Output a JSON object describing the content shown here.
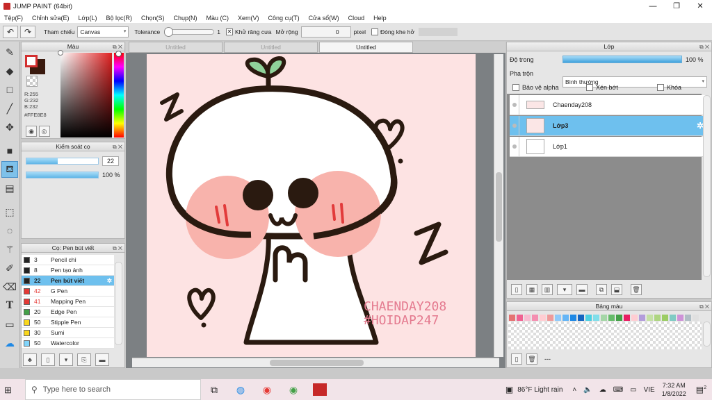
{
  "window": {
    "title": "JUMP PAINT (64bit)",
    "controls": [
      "—",
      "❐",
      "✕"
    ]
  },
  "menu": [
    "Tệp(F)",
    "Chỉnh sửa(E)",
    "Lớp(L)",
    "Bộ lọc(R)",
    "Chọn(S)",
    "Chụp(N)",
    "Màu (C)",
    "Xem(V)",
    "Công cụ(T)",
    "Cửa sổ(W)",
    "Cloud",
    "Help"
  ],
  "toolbar": {
    "undo_icon": "undo-icon",
    "redo_icon": "redo-icon",
    "reference_label": "Tham chiếu",
    "reference_value": "Canvas",
    "tolerance_label": "Tolerance",
    "tolerance_value": "1",
    "antialias_label": "Khử răng cưa",
    "antialias_checked": true,
    "expand_label": "Mở rộng",
    "expand_value": "0",
    "expand_unit": "pixel",
    "close_gap_label": "Đóng khe hở",
    "close_gap_checked": false
  },
  "color_panel": {
    "title": "Màu",
    "r": "R:255",
    "g": "G:232",
    "b": "B:232",
    "hex": "#FFE8E8",
    "fg_color": "#d32f2f",
    "bg_color": "#3a1a0e"
  },
  "brush_control": {
    "title": "Kiểm soát cọ",
    "size": "22",
    "size_fraction": 0.44,
    "opacity": "100 %",
    "opacity_fraction": 1.0
  },
  "brush_list": {
    "title": "Cọ: Pen bút viết",
    "items": [
      {
        "size": "3",
        "name": "Pencil chì",
        "color": "#222222",
        "selected": false
      },
      {
        "size": "8",
        "name": "Pen tạo ảnh",
        "color": "#222222",
        "selected": false
      },
      {
        "size": "22",
        "name": "Pen bút viết",
        "color": "#222222",
        "selected": true
      },
      {
        "size": "42",
        "name": "G Pen",
        "color": "#e53935",
        "selected": false
      },
      {
        "size": "41",
        "name": "Mapping Pen",
        "color": "#e53935",
        "selected": false
      },
      {
        "size": "20",
        "name": "Edge Pen",
        "color": "#43a047",
        "selected": false
      },
      {
        "size": "50",
        "name": "Stipple Pen",
        "color": "#f9d71c",
        "selected": false
      },
      {
        "size": "30",
        "name": "Sumi",
        "color": "#f9d71c",
        "selected": false
      },
      {
        "size": "50",
        "name": "Watercolor",
        "color": "#81d4fa",
        "selected": false
      }
    ]
  },
  "tabs": [
    "Untitled",
    "Untitled",
    "Untitled"
  ],
  "active_tab": 2,
  "artwork": {
    "watermark_line1": "CHAENDAY208",
    "watermark_line2": "#HOIDAP247"
  },
  "layer_panel": {
    "title": "Lớp",
    "opacity_label": "Độ trong",
    "opacity_value": "100 %",
    "blend_label": "Pha trộn",
    "blend_value": "Bình thường",
    "protect_alpha": "Bảo vệ alpha",
    "clip": "Xén bớt",
    "lock": "Khóa",
    "layers": [
      {
        "name": "Chaenday208",
        "selected": false
      },
      {
        "name": "Lớp3",
        "selected": true
      },
      {
        "name": "Lớp1",
        "selected": false
      }
    ]
  },
  "palette": {
    "title": "Bảng màu",
    "status": "---",
    "swatches": [
      "#e57373",
      "#f06292",
      "#f8bbd0",
      "#f48fb1",
      "#ffcdd2",
      "#ef9a9a",
      "#90caf9",
      "#64b5f6",
      "#1e88e5",
      "#1565c0",
      "#4dd0e1",
      "#80deea",
      "#a5d6a7",
      "#66bb6a",
      "#43a047",
      "#e91e63",
      "#ffcdd2",
      "#b39ddb",
      "#c5e1a5",
      "#aed581",
      "#9ccc65",
      "#80cbc4",
      "#ce93d8",
      "#b0bec5",
      "#e0e0e0",
      "#bdbdbd"
    ]
  },
  "taskbar": {
    "search_placeholder": "Type here to search",
    "weather": "86°F  Light rain",
    "lang": "VIE",
    "time": "7:32 AM",
    "date": "1/8/2022",
    "notification_count": "2"
  }
}
